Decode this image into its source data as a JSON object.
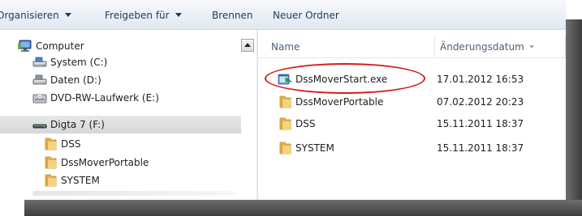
{
  "toolbar": {
    "organize_label": "Organisieren",
    "share_label": "Freigeben für",
    "burn_label": "Brennen",
    "new_folder_label": "Neuer Ordner"
  },
  "nav": {
    "items": [
      {
        "label": "Computer",
        "icon": "computer-icon"
      },
      {
        "label": "System (C:)",
        "icon": "drive-icon"
      },
      {
        "label": "Daten (D:)",
        "icon": "drive-icon"
      },
      {
        "label": "DVD-RW-Laufwerk (E:)",
        "icon": "dvd-drive-icon"
      },
      {
        "label": "Digta 7 (F:)",
        "icon": "removable-drive-icon",
        "selected": true
      },
      {
        "label": "DSS",
        "icon": "folder-icon"
      },
      {
        "label": "DssMoverPortable",
        "icon": "folder-icon"
      },
      {
        "label": "SYSTEM",
        "icon": "folder-icon"
      }
    ]
  },
  "file_list": {
    "columns": {
      "name": "Name",
      "date": "Änderungsdatum"
    },
    "rows": [
      {
        "name": "DssMoverStart.exe",
        "date": "17.01.2012 16:53",
        "icon": "exe-icon"
      },
      {
        "name": "DssMoverPortable",
        "date": "07.02.2012 20:23",
        "icon": "folder-icon"
      },
      {
        "name": "DSS",
        "date": "15.11.2011 18:37",
        "icon": "folder-icon"
      },
      {
        "name": "SYSTEM",
        "date": "15.11.2011 18:37",
        "icon": "folder-icon"
      }
    ]
  },
  "colors": {
    "highlight_oval": "#d41c1c",
    "toolbar_text": "#1e395b",
    "folder": "#e8c26a",
    "selection": "#dcdde0"
  }
}
